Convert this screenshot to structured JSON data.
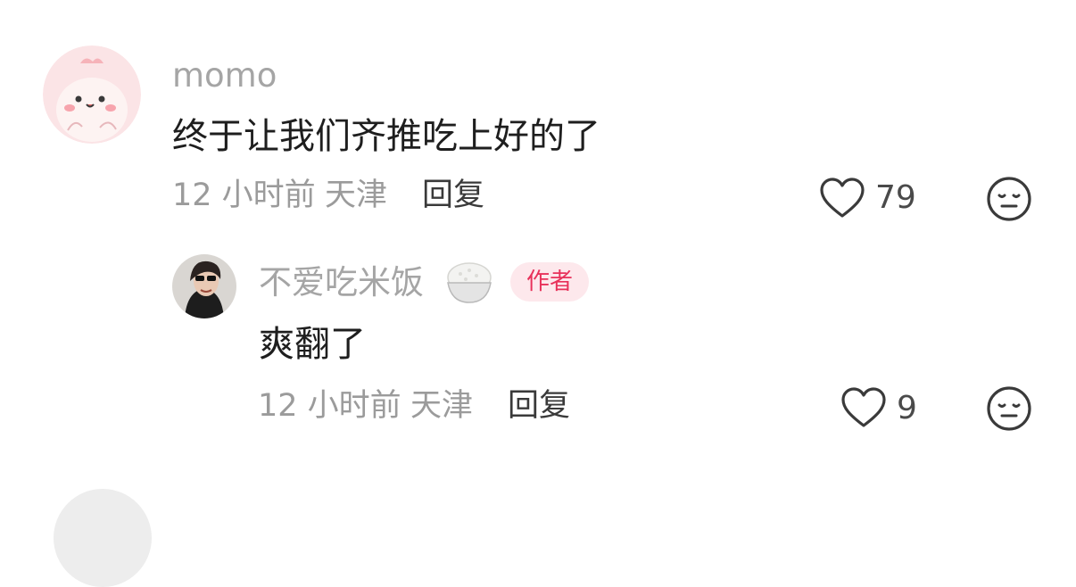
{
  "comments": [
    {
      "username": "momo",
      "text": "终于让我们齐推吃上好的了",
      "time": "12 小时前",
      "location": "天津",
      "reply_label": "回复",
      "likes": "79",
      "avatar": "pink-cartoon-avatar"
    }
  ],
  "replies": [
    {
      "username": "不爱吃米饭",
      "name_emoji": "rice-bowl",
      "badge": "作者",
      "text": "爽翻了",
      "time": "12 小时前",
      "location": "天津",
      "reply_label": "回复",
      "likes": "9",
      "avatar": "woman-sunglasses-photo"
    }
  ],
  "colors": {
    "username": "#a5a5a5",
    "text": "#1e1e1e",
    "meta": "#9b9b9b",
    "badge_bg": "#fde8ec",
    "badge_text": "#e8315a"
  }
}
